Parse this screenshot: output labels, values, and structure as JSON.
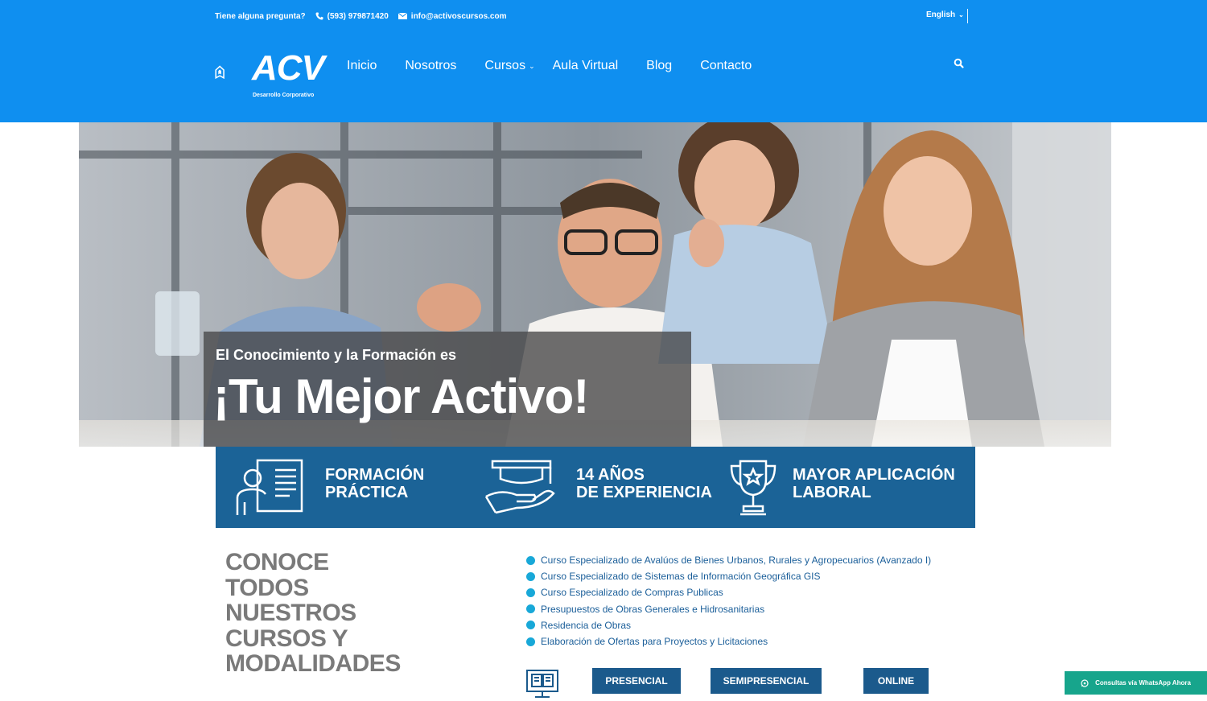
{
  "topbar": {
    "question": "Tiene alguna pregunta?",
    "phone": "(593) 979871420",
    "email": "info@activoscursos.com",
    "language": "English"
  },
  "logo": {
    "wordmark": "ACV",
    "tagline": "Desarrollo Corporativo"
  },
  "nav": {
    "items": [
      {
        "label": "Inicio"
      },
      {
        "label": "Nosotros"
      },
      {
        "label": "Cursos"
      },
      {
        "label": "Aula Virtual"
      },
      {
        "label": "Blog"
      },
      {
        "label": "Contacto"
      }
    ]
  },
  "hero": {
    "subtitle": "El Conocimiento y la Formación es",
    "title": "¡Tu Mejor Activo!"
  },
  "features": [
    {
      "line1": "FORMACIÓN",
      "line2": "PRÁCTICA",
      "icon": "presentation-icon"
    },
    {
      "line1": "14 AÑOS",
      "line2": "DE EXPERIENCIA",
      "icon": "graduation-cap-hand-icon"
    },
    {
      "line1": "MAYOR APLICACIÓN",
      "line2": "LABORAL",
      "icon": "trophy-icon"
    }
  ],
  "conoce": {
    "lines": [
      "CONOCE",
      "TODOS",
      "NUESTROS",
      "CURSOS Y",
      "MODALIDADES"
    ]
  },
  "courses": [
    "Curso Especializado de Avalúos de Bienes Urbanos, Rurales y Agropecuarios (Avanzado I)",
    "Curso Especializado de Sistemas de Información Geográfica GIS",
    "Curso Especializado de Compras Publicas",
    "Presupuestos de Obras Generales e Hidrosanitarias",
    "Residencia de Obras",
    "Elaboración de Ofertas para Proyectos y Licitaciones"
  ],
  "modes": [
    "PRESENCIAL",
    "SEMIPRESENCIAL",
    "ONLINE"
  ],
  "whatsapp": {
    "label": "Consultas vía WhatsApp Ahora"
  },
  "colors": {
    "header_blue": "#0f8ff0",
    "band_blue": "#1b6397",
    "button_blue": "#1b5a8c",
    "dot_cyan": "#18a8d8",
    "whatsapp_green": "#17a58c"
  }
}
